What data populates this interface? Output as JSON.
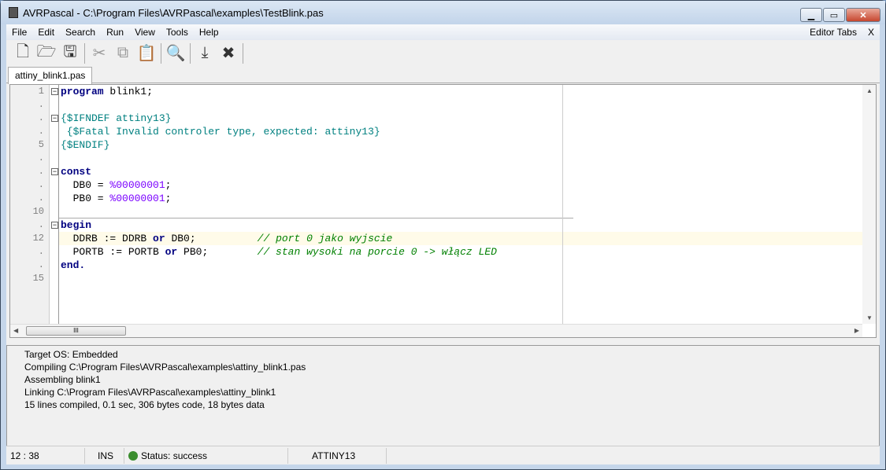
{
  "window": {
    "title": "AVRPascal - C:\\Program Files\\AVRPascal\\examples\\TestBlink.pas"
  },
  "menu": [
    "File",
    "Edit",
    "Search",
    "Run",
    "View",
    "Tools",
    "Help"
  ],
  "menu_right": {
    "editor_tabs": "Editor Tabs",
    "close": "X"
  },
  "toolbar": [
    "new-file",
    "open-folder",
    "save",
    "cut",
    "copy",
    "paste",
    "search",
    "upload",
    "tools"
  ],
  "tab": "attiny_blink1.pas",
  "gutter": [
    "1",
    ".",
    ".",
    ".",
    "5",
    ".",
    ".",
    ".",
    ".",
    "10",
    ".",
    "12",
    ".",
    ".",
    "15"
  ],
  "code": [
    [
      {
        "t": "program",
        "c": "kw"
      },
      {
        "t": " blink1;",
        "c": "tx"
      }
    ],
    [],
    [
      {
        "t": "{$IFNDEF attiny13}",
        "c": "dir"
      }
    ],
    [
      {
        "t": " {$Fatal Invalid controler type, expected: attiny13}",
        "c": "dir"
      }
    ],
    [
      {
        "t": "{$ENDIF}",
        "c": "dir"
      }
    ],
    [],
    [
      {
        "t": "const",
        "c": "kw"
      }
    ],
    [
      {
        "t": "  DB0 = ",
        "c": "tx"
      },
      {
        "t": "%00000001",
        "c": "num"
      },
      {
        "t": ";",
        "c": "tx"
      }
    ],
    [
      {
        "t": "  PB0 = ",
        "c": "tx"
      },
      {
        "t": "%00000001",
        "c": "num"
      },
      {
        "t": ";",
        "c": "tx"
      }
    ],
    [],
    [
      {
        "t": "begin",
        "c": "kw"
      }
    ],
    [
      {
        "t": "  DDRB := DDRB ",
        "c": "tx"
      },
      {
        "t": "or",
        "c": "kw"
      },
      {
        "t": " DB0;          ",
        "c": "tx"
      },
      {
        "t": "// port 0 jako wyjscie",
        "c": "cm"
      }
    ],
    [
      {
        "t": "  PORTB := PORTB ",
        "c": "tx"
      },
      {
        "t": "or",
        "c": "kw"
      },
      {
        "t": " PB0;        ",
        "c": "tx"
      },
      {
        "t": "// stan wysoki na porcie 0 -> włącz LED",
        "c": "cm"
      }
    ],
    [
      {
        "t": "end.",
        "c": "kw"
      }
    ],
    []
  ],
  "output": [
    "Target OS: Embedded",
    "Compiling C:\\Program Files\\AVRPascal\\examples\\attiny_blink1.pas",
    "Assembling blink1",
    "Linking C:\\Program Files\\AVRPascal\\examples\\attiny_blink1",
    "15 lines compiled, 0.1 sec, 306 bytes code, 18 bytes data"
  ],
  "status": {
    "position": "12 : 38",
    "mode": "INS",
    "status": "Status: success",
    "device": "ATTINY13",
    "status_color": "#3a8d2e"
  }
}
